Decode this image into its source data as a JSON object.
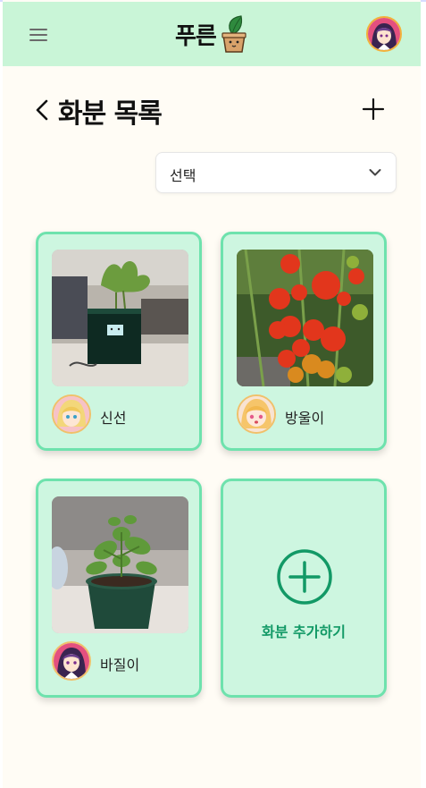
{
  "header": {
    "logo_text": "푸른",
    "menu_icon": "hamburger-menu-icon",
    "logo_icon": "potted-plant-icon",
    "avatar": "user-avatar"
  },
  "page": {
    "title": "화분 목록",
    "back_icon": "chevron-left-icon",
    "add_icon": "plus-icon"
  },
  "filter": {
    "selected": "선택"
  },
  "plants": [
    {
      "name": "신선",
      "photo": "plant-device-photo"
    },
    {
      "name": "방울이",
      "photo": "cherry-tomato-photo"
    },
    {
      "name": "바질이",
      "photo": "basil-pot-photo"
    }
  ],
  "add_card": {
    "label": "화분 추가하기"
  },
  "colors": {
    "header_bg": "#c9f5d7",
    "page_bg": "#fffcf5",
    "card_bg": "#cdf6e0",
    "card_border": "#6ee2ad",
    "accent": "#129966"
  }
}
